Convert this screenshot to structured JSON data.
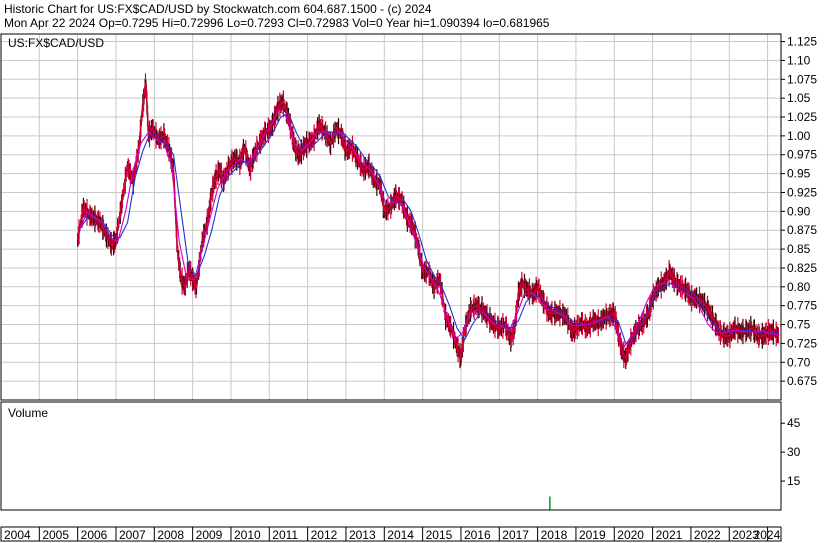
{
  "header": {
    "line1": "Historic Chart for US:FX$CAD/USD by Stockwatch.com 604.687.1500 - (c) 2024",
    "line2": "Mon Apr 22 2024   Op=0.7295   Hi=0.72996   Lo=0.7293   Cl=0.72983   Vol=0   Year hi=1.090394   lo=0.681965"
  },
  "chart_data": [
    {
      "type": "line",
      "title": "US:FX$CAD/USD",
      "ylim": [
        0.65,
        1.135
      ],
      "y_ticks": [
        0.675,
        0.7,
        0.725,
        0.75,
        0.775,
        0.8,
        0.825,
        0.85,
        0.875,
        0.9,
        0.925,
        0.95,
        0.975,
        1.0,
        1.025,
        1.05,
        1.075,
        1.1,
        1.125
      ],
      "y_tick_labels": [
        "0.675",
        "0.70",
        "0.725",
        "0.75",
        "0.775",
        "0.80",
        "0.825",
        "0.85",
        "0.875",
        "0.90",
        "0.925",
        "0.95",
        "0.975",
        "1.00",
        "1.025",
        "1.05",
        "1.075",
        "1.10",
        "1.125"
      ],
      "xlim": [
        2004.0,
        2024.35
      ],
      "x_tick_labels": [
        "2004",
        "2005",
        "2006",
        "2007",
        "2008",
        "2009",
        "2010",
        "2011",
        "2012",
        "2013",
        "2014",
        "2015",
        "2016",
        "2017",
        "2018",
        "2019",
        "2020",
        "2021",
        "2022",
        "2023",
        "2024"
      ],
      "x_tick_values": [
        2004,
        2005,
        2006,
        2007,
        2008,
        2009,
        2010,
        2011,
        2012,
        2013,
        2014,
        2015,
        2016,
        2017,
        2018,
        2019,
        2020,
        2021,
        2022,
        2023,
        2024
      ],
      "grid": true,
      "series": [
        {
          "style": "price",
          "color": "#cc0033",
          "x": [
            2006.0,
            2006.15,
            2006.3,
            2006.45,
            2006.6,
            2006.75,
            2006.9,
            2007.0,
            2007.15,
            2007.3,
            2007.45,
            2007.6,
            2007.7,
            2007.78,
            2007.85,
            2007.95,
            2008.1,
            2008.25,
            2008.4,
            2008.5,
            2008.6,
            2008.7,
            2008.8,
            2008.9,
            2009.0,
            2009.1,
            2009.25,
            2009.4,
            2009.5,
            2009.6,
            2009.7,
            2009.8,
            2009.95,
            2010.1,
            2010.25,
            2010.35,
            2010.5,
            2010.6,
            2010.75,
            2010.9,
            2011.05,
            2011.15,
            2011.25,
            2011.35,
            2011.5,
            2011.6,
            2011.7,
            2011.8,
            2011.9,
            2012.0,
            2012.15,
            2012.3,
            2012.45,
            2012.6,
            2012.75,
            2012.9,
            2013.0,
            2013.15,
            2013.3,
            2013.45,
            2013.6,
            2013.75,
            2013.9,
            2014.0,
            2014.15,
            2014.3,
            2014.45,
            2014.6,
            2014.75,
            2014.9,
            2015.0,
            2015.15,
            2015.3,
            2015.45,
            2015.6,
            2015.75,
            2015.9,
            2016.0,
            2016.1,
            2016.25,
            2016.4,
            2016.55,
            2016.7,
            2016.85,
            2017.0,
            2017.15,
            2017.3,
            2017.4,
            2017.5,
            2017.6,
            2017.75,
            2017.9,
            2018.0,
            2018.15,
            2018.3,
            2018.45,
            2018.6,
            2018.75,
            2018.9,
            2019.0,
            2019.15,
            2019.3,
            2019.45,
            2019.6,
            2019.75,
            2019.9,
            2020.0,
            2020.1,
            2020.2,
            2020.3,
            2020.45,
            2020.6,
            2020.75,
            2020.9,
            2021.0,
            2021.15,
            2021.3,
            2021.45,
            2021.6,
            2021.75,
            2021.9,
            2022.0,
            2022.15,
            2022.3,
            2022.45,
            2022.6,
            2022.75,
            2022.9,
            2023.0,
            2023.15,
            2023.3,
            2023.45,
            2023.6,
            2023.75,
            2023.9,
            2024.0,
            2024.15,
            2024.3
          ],
          "y": [
            0.862,
            0.905,
            0.895,
            0.89,
            0.885,
            0.868,
            0.855,
            0.862,
            0.91,
            0.96,
            0.94,
            0.985,
            1.04,
            1.07,
            1.0,
            1.01,
            0.995,
            1.0,
            0.98,
            0.955,
            0.85,
            0.81,
            0.8,
            0.825,
            0.81,
            0.8,
            0.86,
            0.89,
            0.925,
            0.945,
            0.955,
            0.94,
            0.96,
            0.97,
            0.965,
            0.985,
            0.955,
            0.975,
            0.99,
            1.005,
            1.01,
            1.025,
            1.04,
            1.045,
            1.025,
            1.0,
            0.98,
            0.975,
            0.985,
            0.99,
            0.995,
            1.015,
            1.005,
            0.99,
            1.01,
            1.0,
            0.98,
            0.985,
            0.97,
            0.955,
            0.96,
            0.94,
            0.935,
            0.9,
            0.905,
            0.92,
            0.915,
            0.89,
            0.88,
            0.85,
            0.82,
            0.82,
            0.8,
            0.81,
            0.76,
            0.745,
            0.72,
            0.705,
            0.745,
            0.77,
            0.775,
            0.77,
            0.76,
            0.75,
            0.745,
            0.75,
            0.73,
            0.745,
            0.79,
            0.805,
            0.795,
            0.79,
            0.8,
            0.78,
            0.765,
            0.765,
            0.765,
            0.76,
            0.74,
            0.745,
            0.752,
            0.745,
            0.755,
            0.752,
            0.76,
            0.762,
            0.765,
            0.74,
            0.715,
            0.705,
            0.73,
            0.745,
            0.752,
            0.765,
            0.785,
            0.8,
            0.805,
            0.82,
            0.805,
            0.8,
            0.795,
            0.785,
            0.785,
            0.78,
            0.77,
            0.755,
            0.74,
            0.735,
            0.735,
            0.745,
            0.74,
            0.742,
            0.745,
            0.735,
            0.735,
            0.74,
            0.74,
            0.735
          ]
        },
        {
          "style": "moving-average",
          "color": "#2233cc",
          "x": [
            2006.1,
            2006.3,
            2006.5,
            2006.7,
            2006.9,
            2007.1,
            2007.3,
            2007.5,
            2007.7,
            2007.9,
            2008.1,
            2008.3,
            2008.5,
            2008.7,
            2008.9,
            2009.1,
            2009.3,
            2009.5,
            2009.7,
            2009.9,
            2010.1,
            2010.3,
            2010.5,
            2010.7,
            2010.9,
            2011.1,
            2011.3,
            2011.5,
            2011.7,
            2011.9,
            2012.1,
            2012.3,
            2012.5,
            2012.7,
            2012.9,
            2013.1,
            2013.3,
            2013.5,
            2013.7,
            2013.9,
            2014.1,
            2014.3,
            2014.5,
            2014.7,
            2014.9,
            2015.1,
            2015.3,
            2015.5,
            2015.7,
            2015.9,
            2016.1,
            2016.3,
            2016.5,
            2016.7,
            2016.9,
            2017.1,
            2017.3,
            2017.5,
            2017.7,
            2017.9,
            2018.1,
            2018.3,
            2018.5,
            2018.7,
            2018.9,
            2019.1,
            2019.3,
            2019.5,
            2019.7,
            2019.9,
            2020.1,
            2020.3,
            2020.5,
            2020.7,
            2020.9,
            2021.1,
            2021.3,
            2021.5,
            2021.7,
            2021.9,
            2022.1,
            2022.3,
            2022.5,
            2022.7,
            2022.9,
            2023.1,
            2023.3,
            2023.5,
            2023.7,
            2023.9,
            2024.1,
            2024.3
          ],
          "y": [
            0.88,
            0.895,
            0.89,
            0.883,
            0.868,
            0.865,
            0.885,
            0.945,
            0.98,
            1.005,
            1.0,
            0.99,
            0.975,
            0.9,
            0.825,
            0.815,
            0.84,
            0.875,
            0.92,
            0.945,
            0.955,
            0.965,
            0.965,
            0.975,
            0.99,
            1.005,
            1.025,
            1.03,
            1.005,
            0.985,
            0.985,
            0.995,
            1.005,
            1.005,
            1.005,
            0.995,
            0.985,
            0.97,
            0.96,
            0.945,
            0.92,
            0.91,
            0.915,
            0.9,
            0.87,
            0.835,
            0.815,
            0.8,
            0.775,
            0.745,
            0.73,
            0.75,
            0.765,
            0.765,
            0.755,
            0.75,
            0.745,
            0.755,
            0.78,
            0.79,
            0.785,
            0.775,
            0.77,
            0.765,
            0.755,
            0.75,
            0.75,
            0.752,
            0.755,
            0.758,
            0.755,
            0.725,
            0.73,
            0.75,
            0.77,
            0.79,
            0.8,
            0.805,
            0.8,
            0.795,
            0.79,
            0.775,
            0.755,
            0.745,
            0.74,
            0.74,
            0.742,
            0.742,
            0.74,
            0.74,
            0.74,
            0.738
          ]
        },
        {
          "style": "moving-average",
          "color": "#cc00cc",
          "x": [
            2006.05,
            2006.25,
            2006.45,
            2006.65,
            2006.85,
            2007.05,
            2007.25,
            2007.45,
            2007.65,
            2007.85,
            2008.05,
            2008.25,
            2008.45,
            2008.65,
            2008.85,
            2009.05,
            2009.25,
            2009.45,
            2009.65,
            2009.85,
            2010.05,
            2010.25,
            2010.45,
            2010.65,
            2010.85,
            2011.05,
            2011.25,
            2011.45,
            2011.65,
            2011.85,
            2012.05,
            2012.25,
            2012.45,
            2012.65,
            2012.85,
            2013.05,
            2013.25,
            2013.45,
            2013.65,
            2013.85,
            2014.05,
            2014.25,
            2014.45,
            2014.65,
            2014.85,
            2015.05,
            2015.25,
            2015.45,
            2015.65,
            2015.85,
            2016.05,
            2016.25,
            2016.45,
            2016.65,
            2016.85,
            2017.05,
            2017.25,
            2017.45,
            2017.65,
            2017.85,
            2018.05,
            2018.25,
            2018.45,
            2018.65,
            2018.85,
            2019.05,
            2019.25,
            2019.45,
            2019.65,
            2019.85,
            2020.05,
            2020.25,
            2020.45,
            2020.65,
            2020.85,
            2021.05,
            2021.25,
            2021.45,
            2021.65,
            2021.85,
            2022.05,
            2022.25,
            2022.45,
            2022.65,
            2022.85,
            2023.05,
            2023.25,
            2023.45,
            2023.65,
            2023.85,
            2024.05,
            2024.3
          ],
          "y": [
            0.875,
            0.9,
            0.892,
            0.885,
            0.865,
            0.86,
            0.9,
            0.955,
            0.99,
            1.005,
            0.995,
            0.99,
            0.96,
            0.86,
            0.81,
            0.81,
            0.85,
            0.89,
            0.93,
            0.95,
            0.96,
            0.97,
            0.962,
            0.98,
            1.0,
            1.015,
            1.035,
            1.025,
            0.99,
            0.98,
            0.99,
            1.005,
            1.005,
            1.0,
            1.005,
            0.99,
            0.978,
            0.962,
            0.955,
            0.935,
            0.91,
            0.912,
            0.91,
            0.885,
            0.855,
            0.825,
            0.81,
            0.79,
            0.76,
            0.73,
            0.74,
            0.765,
            0.77,
            0.762,
            0.752,
            0.748,
            0.742,
            0.762,
            0.79,
            0.792,
            0.782,
            0.77,
            0.768,
            0.762,
            0.75,
            0.748,
            0.75,
            0.752,
            0.757,
            0.76,
            0.745,
            0.72,
            0.735,
            0.755,
            0.78,
            0.8,
            0.805,
            0.805,
            0.798,
            0.792,
            0.785,
            0.77,
            0.75,
            0.74,
            0.738,
            0.742,
            0.742,
            0.74,
            0.74,
            0.742,
            0.738,
            0.736
          ]
        }
      ]
    },
    {
      "type": "bar",
      "title": "Volume",
      "ylim": [
        0,
        56
      ],
      "y_ticks": [
        15,
        30,
        45
      ],
      "y_tick_labels": [
        "15",
        "30",
        "45"
      ],
      "x": [
        2018.32
      ],
      "values": [
        7
      ],
      "color": "#00aa00"
    }
  ]
}
